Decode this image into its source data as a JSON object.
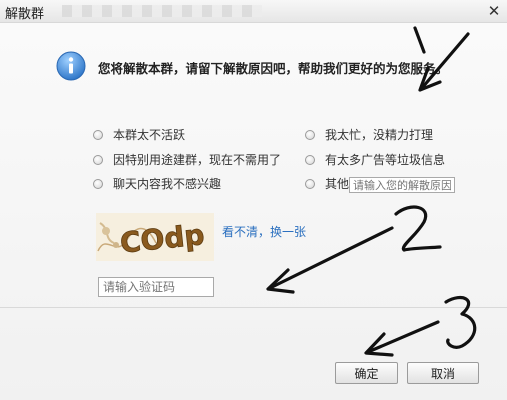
{
  "window": {
    "title": "解散群",
    "close_glyph": "✕"
  },
  "main": {
    "headline": "您将解散本群，请留下解散原因吧，帮助我们更好的为您服务。",
    "reasons": [
      {
        "label": "本群太不活跃"
      },
      {
        "label": "我太忙，没精力打理"
      },
      {
        "label": "因特别用途建群，现在不需用了"
      },
      {
        "label": "有太多广告等垃圾信息"
      },
      {
        "label": "聊天内容我不感兴趣"
      },
      {
        "label": "其他"
      }
    ],
    "other_reason_placeholder": "请输入您的解散原因",
    "captcha_text": "COdp",
    "refresh_link": "看不清，换一张",
    "code_placeholder": "请输入验证码"
  },
  "buttons": {
    "ok": "确定",
    "cancel": "取消"
  },
  "annotations": {
    "labels": [
      "1",
      "2",
      "3"
    ]
  },
  "colors": {
    "link": "#2a6fbf",
    "info_icon": "#3f87d6"
  }
}
